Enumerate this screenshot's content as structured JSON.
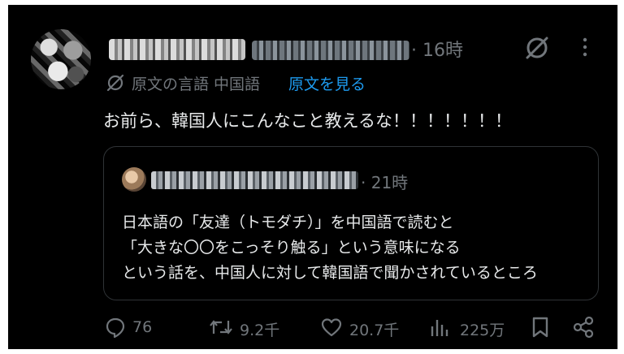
{
  "post": {
    "time": "· 16時",
    "original_language": "原文の言語 中国語",
    "show_original": "原文を見る",
    "body": "お前ら、韓国人にこんなこと教えるな！！！！！！！"
  },
  "quote": {
    "time": "· 21時",
    "lines": [
      "日本語の「友達（トモダチ）」を中国語で読むと",
      "「大きな〇〇をこっそり触る」という意味になる",
      "という話を、中国人に対して韓国語で聞かされているところ"
    ]
  },
  "actions": {
    "replies": "76",
    "reposts": "9.2千",
    "likes": "20.7千",
    "views": "225万"
  }
}
